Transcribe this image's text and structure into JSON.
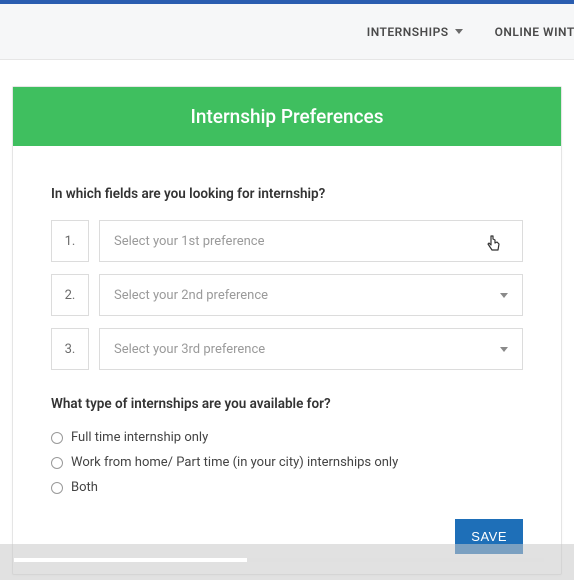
{
  "nav": {
    "internships_label": "INTERNSHIPS",
    "online_winter_label": "ONLINE WINTE"
  },
  "card": {
    "title": "Internship Preferences",
    "q1_label": "In which fields are you looking for internship?",
    "prefs": [
      {
        "num": "1.",
        "placeholder": "Select your 1st preference"
      },
      {
        "num": "2.",
        "placeholder": "Select your 2nd preference"
      },
      {
        "num": "3.",
        "placeholder": "Select your 3rd preference"
      }
    ],
    "q2_label": "What type of internships are you available for?",
    "options": [
      {
        "label": "Full time internship only"
      },
      {
        "label": "Work from home/ Part time (in your city) internships only"
      },
      {
        "label": "Both"
      }
    ],
    "save_label": "SAVE"
  }
}
